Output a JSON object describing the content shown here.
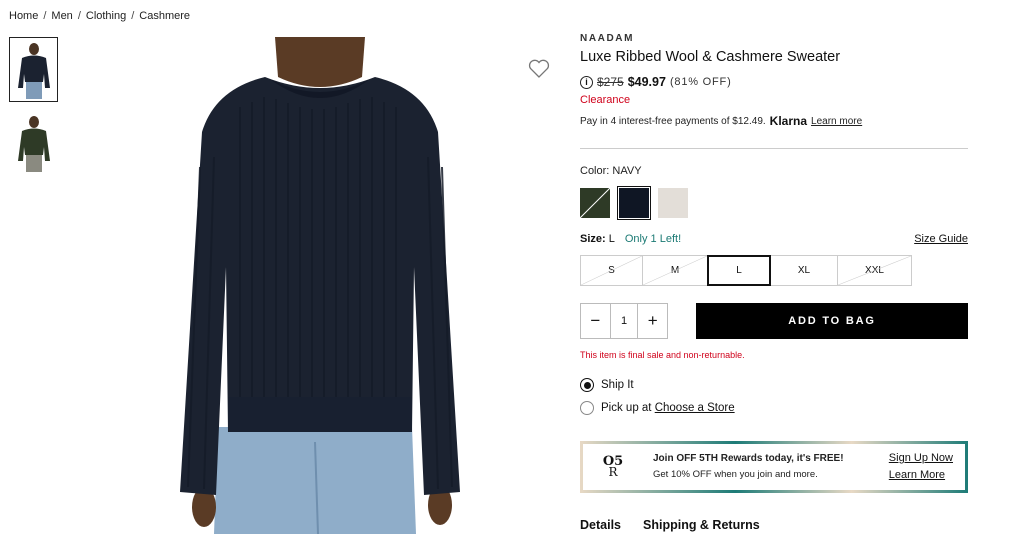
{
  "breadcrumb": [
    "Home",
    "Men",
    "Clothing",
    "Cashmere"
  ],
  "breadcrumb_sep": "/",
  "product": {
    "brand": "NAADAM",
    "title": "Luxe Ribbed Wool & Cashmere Sweater",
    "price_old": "$275",
    "price_new": "$49.97",
    "discount": "(81% OFF)",
    "clearance": "Clearance",
    "klarna_text": "Pay in 4 interest-free payments of $12.49.",
    "klarna_logo": "Klarna",
    "klarna_learn": "Learn more"
  },
  "color": {
    "label": "Color:",
    "value": "NAVY",
    "swatches": [
      "#2e3a26",
      "#0f1624",
      "#e3ded8"
    ]
  },
  "size": {
    "label": "Size:",
    "value": "L",
    "availability": "Only 1 Left!",
    "guide": "Size Guide",
    "options": [
      "S",
      "M",
      "L",
      "XL",
      "XXL"
    ]
  },
  "quantity": {
    "value": "1",
    "minus": "−",
    "plus": "+"
  },
  "add_to_bag": "ADD TO BAG",
  "final_sale": "This item is final sale and non-returnable.",
  "delivery": {
    "ship": "Ship It",
    "pickup_prefix": "Pick up at",
    "pickup_link": "Choose a Store"
  },
  "promo": {
    "logo_top": "O5",
    "logo_bottom": "R",
    "headline": "Join OFF 5TH Rewards today, it's FREE!",
    "sub": "Get 10% OFF when you join and more.",
    "link1": "Sign Up Now",
    "link2": "Learn More"
  },
  "tabs": [
    "Details",
    "Shipping & Returns"
  ],
  "colors": {
    "accent_red": "#d0021b",
    "teal": "#1b7a74",
    "sweater_navy": "#1b2230"
  }
}
